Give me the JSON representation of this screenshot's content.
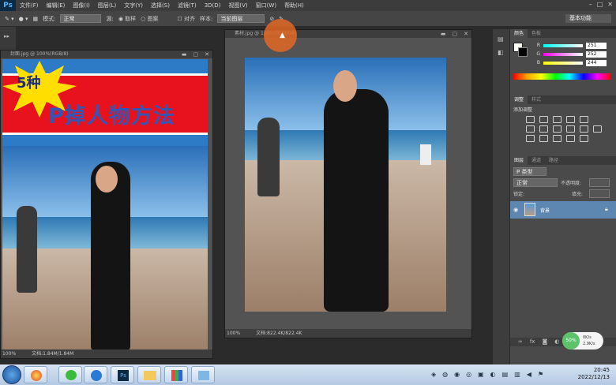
{
  "app": {
    "logo": "Ps"
  },
  "menu": [
    "文件(F)",
    "编辑(E)",
    "图像(I)",
    "图层(L)",
    "文字(Y)",
    "选择(S)",
    "滤镜(T)",
    "3D(D)",
    "视图(V)",
    "窗口(W)",
    "帮助(H)"
  ],
  "options": {
    "mode_label": "模式:",
    "mode_value": "正常",
    "source_label": "源:",
    "source_option_1": "取样",
    "source_option_2": "图案",
    "align_label": "对齐",
    "sample_label": "样本:",
    "sample_value": "当前图层",
    "workspace": "基本功能"
  },
  "doc1": {
    "title": "封面.jpg @ 100%(RGB/8)",
    "banner_number": "5种",
    "banner_text": "P掉人物方法",
    "zoom": "100%",
    "doc_size": "文档:1.84M/1.84M"
  },
  "doc2": {
    "title": "素材.jpg @ 100%(RGB/8#)",
    "zoom": "100%",
    "doc_size": "文档:822.4K/822.4K"
  },
  "color_panel": {
    "tabs": [
      "颜色",
      "色板"
    ],
    "channels": [
      {
        "label": "R",
        "value": "251"
      },
      {
        "label": "G",
        "value": "252"
      },
      {
        "label": "B",
        "value": "244"
      }
    ]
  },
  "adjust_panel": {
    "tabs": [
      "调整",
      "样式"
    ],
    "hint": "添加调整"
  },
  "layers_panel": {
    "tabs": [
      "图层",
      "通道",
      "路径"
    ],
    "kind": "P 类型",
    "blend": "正常",
    "opacity_label": "不透明度:",
    "lock_label": "锁定:",
    "fill_label": "填充:",
    "layer_name": "背景"
  },
  "network": {
    "percent": "50%",
    "up": "0K/s",
    "down": "2.9K/s"
  },
  "clock": {
    "time": "20:45",
    "date": "2022/12/13"
  },
  "colors": {
    "accent": "#e26826",
    "layer_selected": "#5d86b0",
    "banner_red": "#e8121e"
  }
}
